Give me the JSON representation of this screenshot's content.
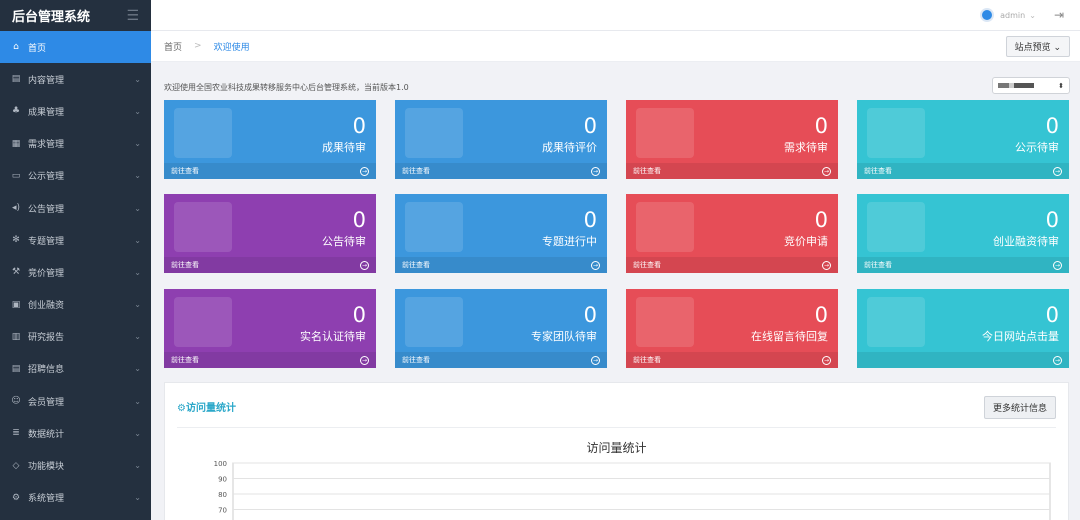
{
  "brand": {
    "title": "后台管理系统",
    "menu_icon": "hamburger-icon"
  },
  "sidebar": {
    "items": [
      {
        "label": "首页",
        "icon": "home-icon",
        "glyph": "⌂",
        "active": true,
        "chev": ""
      },
      {
        "label": "内容管理",
        "icon": "document-icon",
        "glyph": "▤",
        "active": false,
        "chev": "⌄"
      },
      {
        "label": "成果管理",
        "icon": "handshake-icon",
        "glyph": "♣",
        "active": false,
        "chev": "⌄"
      },
      {
        "label": "需求管理",
        "icon": "list-icon",
        "glyph": "▦",
        "active": false,
        "chev": "⌄"
      },
      {
        "label": "公示管理",
        "icon": "monitor-icon",
        "glyph": "▭",
        "active": false,
        "chev": "⌄"
      },
      {
        "label": "公告管理",
        "icon": "speaker-icon",
        "glyph": "◂)",
        "active": false,
        "chev": "⌄"
      },
      {
        "label": "专题管理",
        "icon": "star-icon",
        "glyph": "✻",
        "active": false,
        "chev": "⌄"
      },
      {
        "label": "竞价管理",
        "icon": "gavel-icon",
        "glyph": "⚒",
        "active": false,
        "chev": "⌄"
      },
      {
        "label": "创业融资",
        "icon": "briefcase-icon",
        "glyph": "▣",
        "active": false,
        "chev": "⌄"
      },
      {
        "label": "研究报告",
        "icon": "report-icon",
        "glyph": "▥",
        "active": false,
        "chev": "⌄"
      },
      {
        "label": "招聘信息",
        "icon": "newspaper-icon",
        "glyph": "▤",
        "active": false,
        "chev": "⌄"
      },
      {
        "label": "会员管理",
        "icon": "user-icon",
        "glyph": "☺",
        "active": false,
        "chev": "⌄"
      },
      {
        "label": "数据统计",
        "icon": "database-icon",
        "glyph": "≣",
        "active": false,
        "chev": "⌄"
      },
      {
        "label": "功能模块",
        "icon": "tag-icon",
        "glyph": "◇",
        "active": false,
        "chev": "⌄"
      },
      {
        "label": "系统管理",
        "icon": "gear-icon",
        "glyph": "⚙",
        "active": false,
        "chev": "⌄"
      }
    ]
  },
  "topbar": {
    "username": "admin",
    "user_chev": "⌄",
    "logout_glyph": "⇥"
  },
  "breadcrumb": {
    "home": "首页",
    "sep": ">",
    "current": "欢迎使用"
  },
  "preview_button": "站点预览 ⌄",
  "welcome_text": "欢迎使用全国农业科技成果转移服务中心后台管理系统，当前版本1.0",
  "select_arrow": "⬍",
  "cards": [
    {
      "value": "0",
      "title": "成果待审",
      "link": "前往查看",
      "color": "blue"
    },
    {
      "value": "0",
      "title": "成果待评价",
      "link": "前往查看",
      "color": "blue"
    },
    {
      "value": "0",
      "title": "需求待审",
      "link": "前往查看",
      "color": "red"
    },
    {
      "value": "0",
      "title": "公示待审",
      "link": "前往查看",
      "color": "teal"
    },
    {
      "value": "0",
      "title": "公告待审",
      "link": "前往查看",
      "color": "purple"
    },
    {
      "value": "0",
      "title": "专题进行中",
      "link": "前往查看",
      "color": "blue"
    },
    {
      "value": "0",
      "title": "竞价申请",
      "link": "前往查看",
      "color": "red"
    },
    {
      "value": "0",
      "title": "创业融资待审",
      "link": "前往查看",
      "color": "teal"
    },
    {
      "value": "0",
      "title": "实名认证待审",
      "link": "前往查看",
      "color": "purple"
    },
    {
      "value": "0",
      "title": "专家团队待审",
      "link": "前往查看",
      "color": "blue"
    },
    {
      "value": "0",
      "title": "在线留言待回复",
      "link": "前往查看",
      "color": "red"
    },
    {
      "value": "0",
      "title": "今日网站点击量",
      "link": "",
      "color": "teal"
    }
  ],
  "stats": {
    "title": "⚙访问量统计",
    "more_button": "更多统计信息"
  },
  "chart_data": {
    "type": "line",
    "title": "访问量统计",
    "y_ticks": [
      "100",
      "90",
      "80",
      "70"
    ],
    "ylim": [
      70,
      100
    ],
    "series": []
  }
}
